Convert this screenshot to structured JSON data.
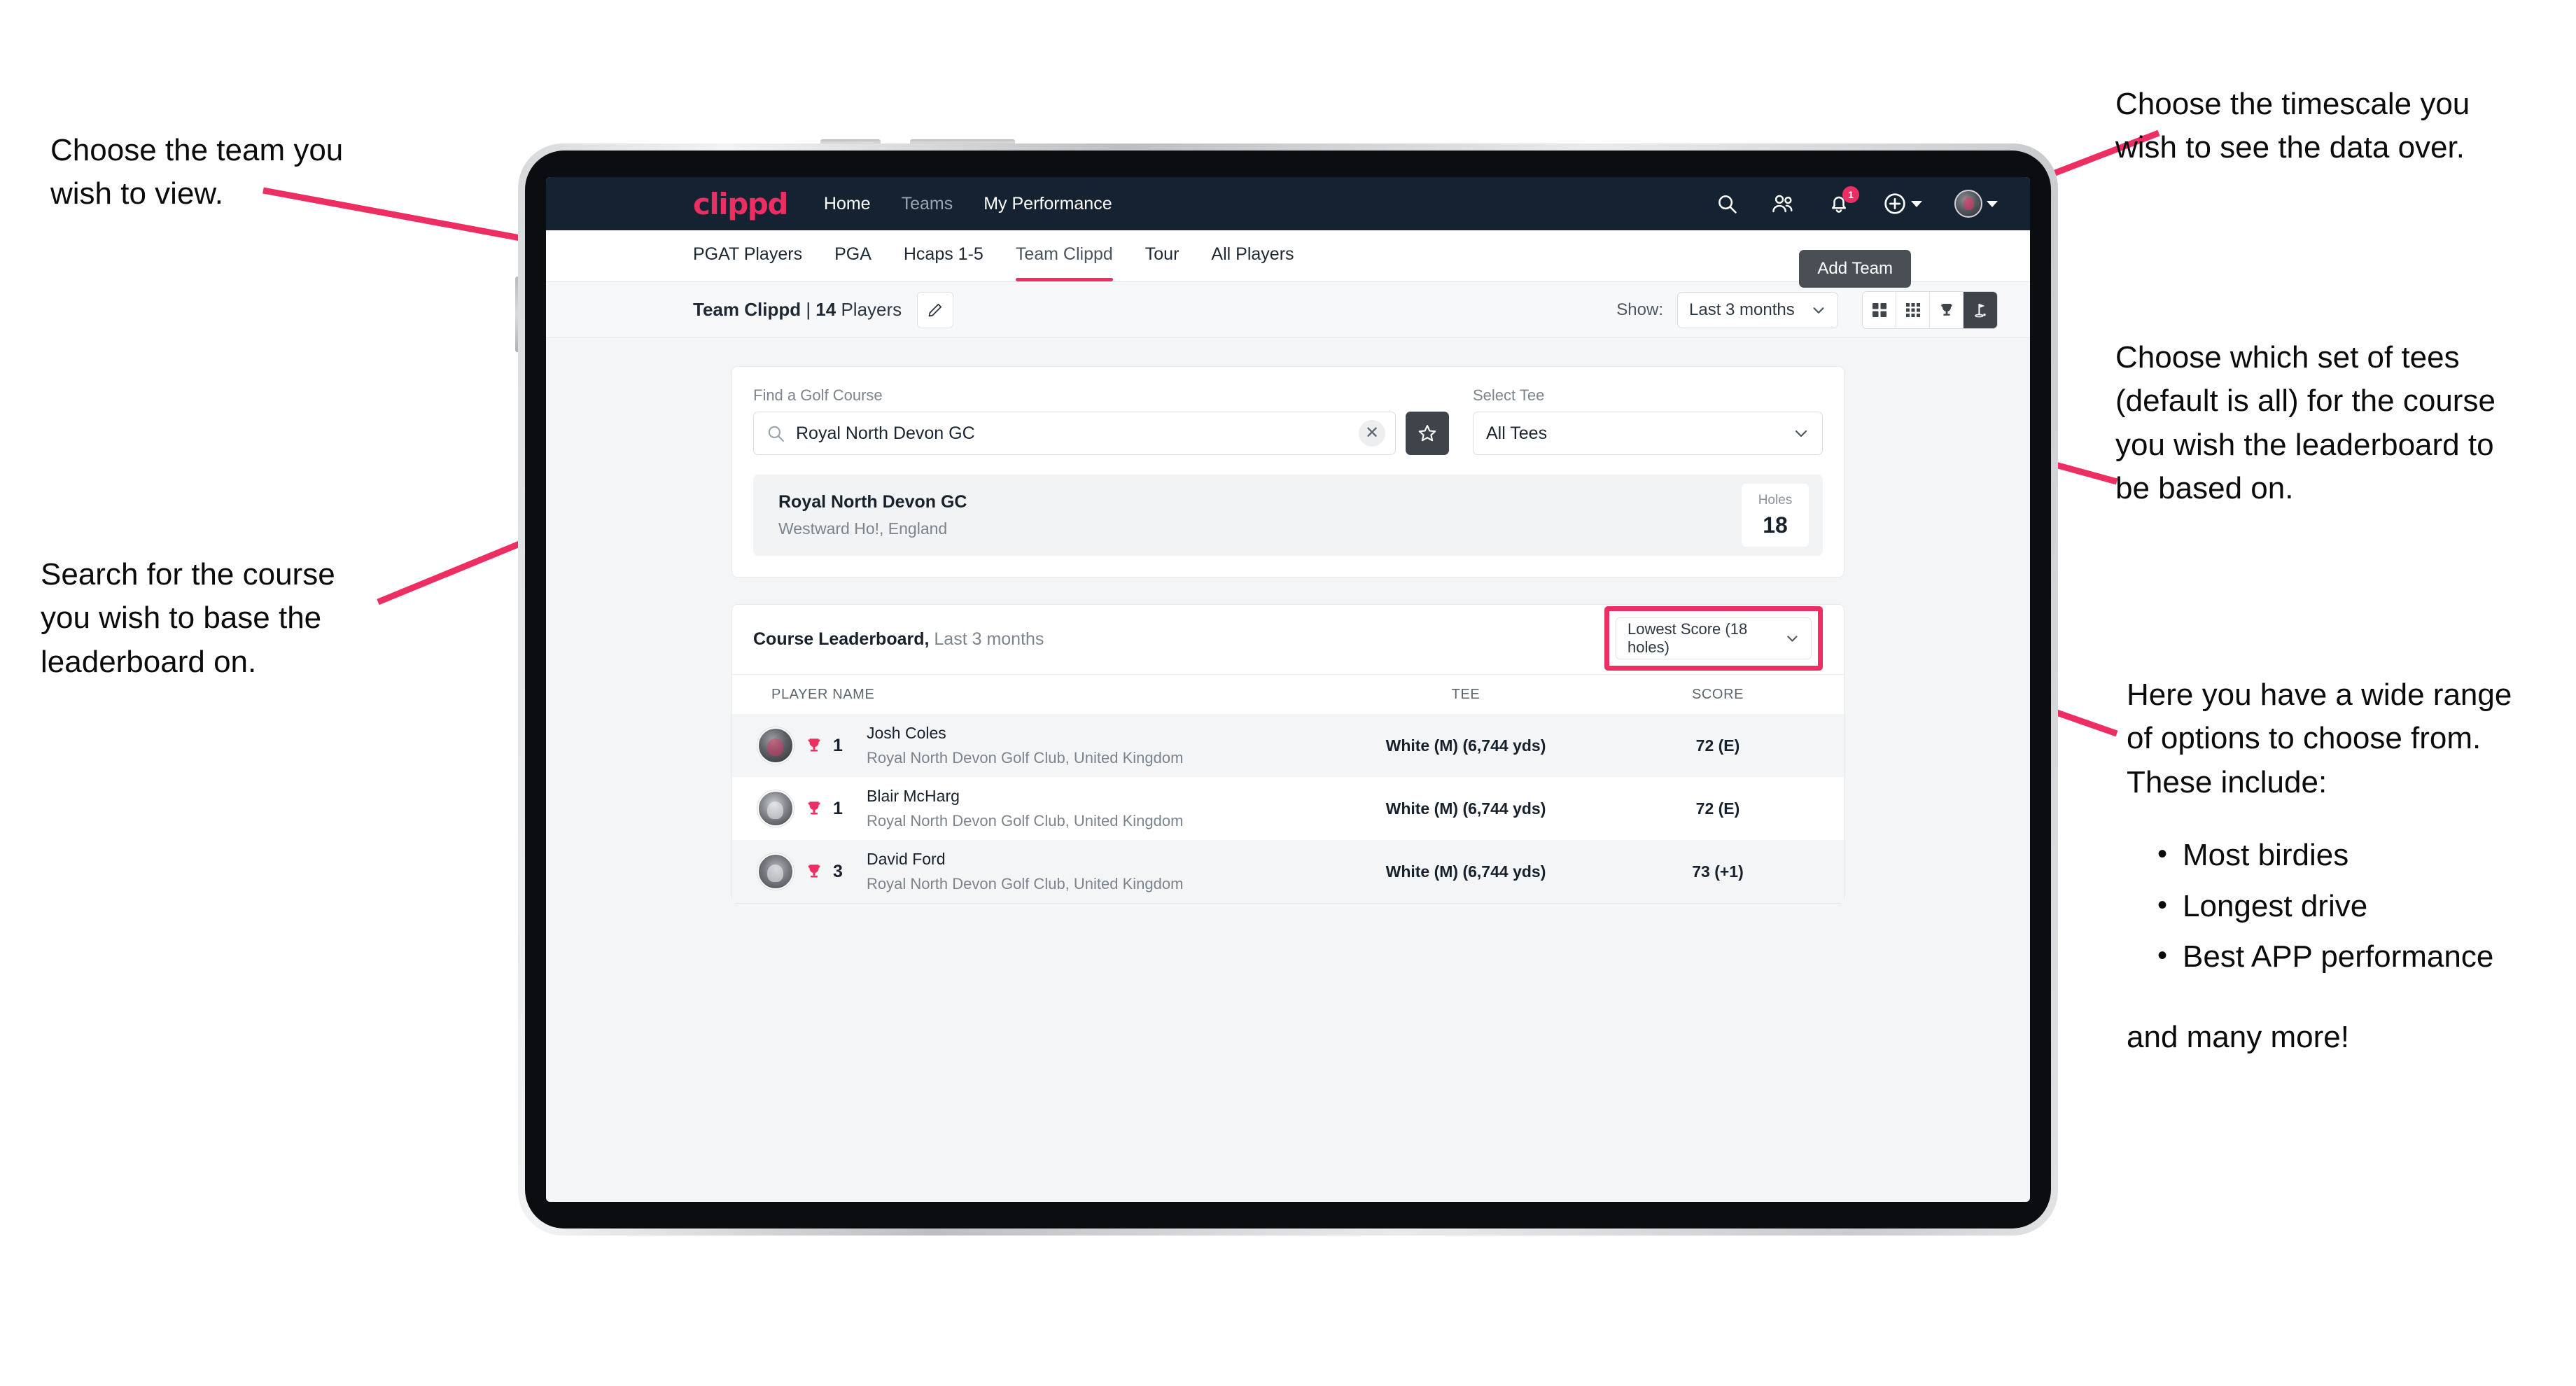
{
  "annotations": {
    "team": "Choose the team you\nwish to view.",
    "search": "Search for the course\nyou wish to base the\nleaderboard on.",
    "timescale": "Choose the timescale you\nwish to see the data over.",
    "tees": "Choose which set of tees\n(default is all) for the course\nyou wish the leaderboard to\nbe based on.",
    "options_intro": "Here you have a wide range\nof options to choose from.\nThese include:",
    "options_list": [
      "Most birdies",
      "Longest drive",
      "Best APP performance"
    ],
    "options_outro": "and many more!"
  },
  "app": {
    "brand": "clippd",
    "nav_links": [
      {
        "label": "Home",
        "active": true
      },
      {
        "label": "Teams",
        "active": false
      },
      {
        "label": "My Performance",
        "active": true
      }
    ],
    "nav_icons": [
      "search-icon",
      "people-icon",
      "bell-icon",
      "plus-circle-icon",
      "avatar-icon"
    ],
    "notification_count": "1",
    "tabs": [
      {
        "label": "PGAT Players",
        "state": "normal"
      },
      {
        "label": "PGA",
        "state": "normal"
      },
      {
        "label": "Hcaps 1-5",
        "state": "normal"
      },
      {
        "label": "Team Clippd",
        "state": "active"
      },
      {
        "label": "Tour",
        "state": "normal"
      },
      {
        "label": "All Players",
        "state": "normal"
      }
    ],
    "add_team_label": "Add Team",
    "subbar": {
      "team_name": "Team Clippd",
      "separator": " | ",
      "player_count": "14",
      "players_word": "Players",
      "edit_icon": "pencil-icon",
      "show_label": "Show:",
      "timescale_value": "Last 3 months",
      "view_buttons": [
        "grid-large-icon",
        "grid-small-icon",
        "trophy-icon",
        "golf-flag-icon"
      ],
      "active_view": "golf-flag-icon"
    },
    "search_panel": {
      "course_label": "Find a Golf Course",
      "course_value": "Royal North Devon GC",
      "course_placeholder": "Find a Golf Course",
      "clear_icon": "close-icon",
      "favourite_icon": "star-icon",
      "tee_label": "Select Tee",
      "tee_value": "All Tees"
    },
    "course_result": {
      "name": "Royal North Devon GC",
      "location": "Westward Ho!, England",
      "holes_label": "Holes",
      "holes_value": "18"
    },
    "leaderboard": {
      "title": "Course Leaderboard,",
      "subtitle": " Last 3 months",
      "sort_value": "Lowest Score (18 holes)",
      "columns": [
        "PLAYER NAME",
        "TEE",
        "SCORE"
      ],
      "rows": [
        {
          "rank": "1",
          "name": "Josh Coles",
          "club": "Royal North Devon Golf Club, United Kingdom",
          "tee": "White (M) (6,744 yds)",
          "score": "72 (E)"
        },
        {
          "rank": "1",
          "name": "Blair McHarg",
          "club": "Royal North Devon Golf Club, United Kingdom",
          "tee": "White (M) (6,744 yds)",
          "score": "72 (E)"
        },
        {
          "rank": "3",
          "name": "David Ford",
          "club": "Royal North Devon Golf Club, United Kingdom",
          "tee": "White (M) (6,744 yds)",
          "score": "73 (+1)"
        }
      ]
    }
  },
  "colors": {
    "accent_pink": "#ec2e62",
    "nav_dark": "#152231",
    "button_dark": "#3f444b",
    "page_bg": "#f4f5f7"
  }
}
